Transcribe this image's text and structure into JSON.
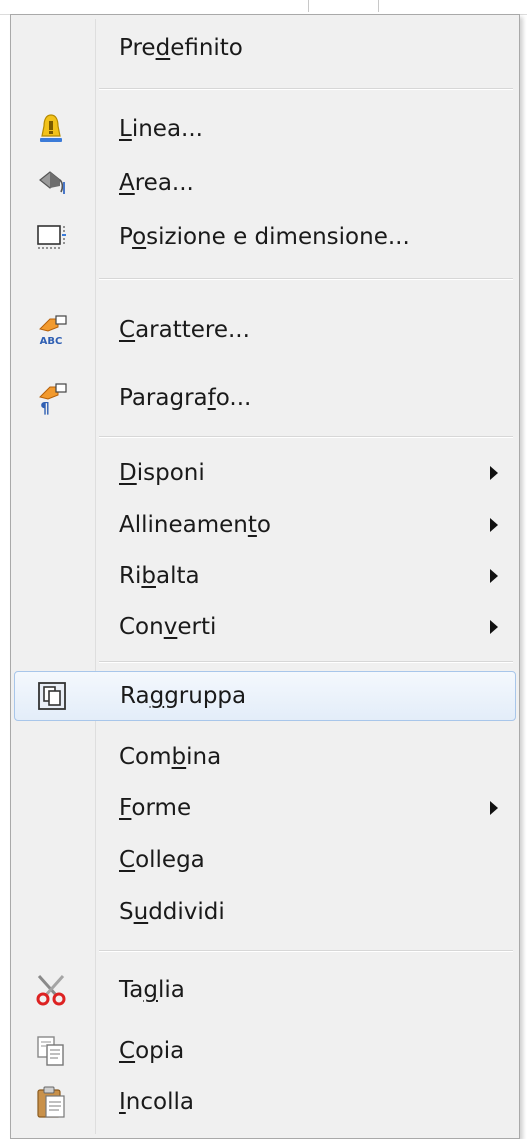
{
  "menu": {
    "items": [
      {
        "label": "Predefinito",
        "underline_index": 3,
        "icon": null,
        "submenu": false
      },
      {
        "label": "Linea...",
        "underline_index": 0,
        "icon": "line-icon",
        "submenu": false
      },
      {
        "label": "Area...",
        "underline_index": 0,
        "icon": "area-icon",
        "submenu": false
      },
      {
        "label": "Posizione e dimensione...",
        "underline_index": 1,
        "icon": "position-size-icon",
        "submenu": false
      },
      {
        "label": "Carattere...",
        "underline_index": 0,
        "icon": "character-icon",
        "submenu": false
      },
      {
        "label": "Paragrafo...",
        "underline_index": 7,
        "icon": "paragraph-icon",
        "submenu": false
      },
      {
        "label": "Disponi",
        "underline_index": 0,
        "icon": null,
        "submenu": true
      },
      {
        "label": "Allineamento",
        "underline_index": 10,
        "icon": null,
        "submenu": true
      },
      {
        "label": "Ribalta",
        "underline_index": 2,
        "icon": null,
        "submenu": true
      },
      {
        "label": "Converti",
        "underline_index": 3,
        "icon": null,
        "submenu": true
      },
      {
        "label": "Raggruppa",
        "underline_index": 2,
        "icon": "group-icon",
        "submenu": false,
        "highlighted": true
      },
      {
        "label": "Combina",
        "underline_index": 3,
        "icon": null,
        "submenu": false
      },
      {
        "label": "Forme",
        "underline_index": 0,
        "icon": null,
        "submenu": true
      },
      {
        "label": "Collega",
        "underline_index": 0,
        "icon": null,
        "submenu": false
      },
      {
        "label": "Suddividi",
        "underline_index": 1,
        "icon": null,
        "submenu": false
      },
      {
        "label": "Taglia",
        "underline_index": 2,
        "icon": "scissors-icon",
        "submenu": false
      },
      {
        "label": "Copia",
        "underline_index": 0,
        "icon": "copy-icon",
        "submenu": false
      },
      {
        "label": "Incolla",
        "underline_index": 0,
        "icon": "paste-icon",
        "submenu": false
      }
    ]
  },
  "colors": {
    "menu_background": "#f0f0f0",
    "highlight_border": "#a8c6ea",
    "highlight_fill": "#e3edf9"
  }
}
